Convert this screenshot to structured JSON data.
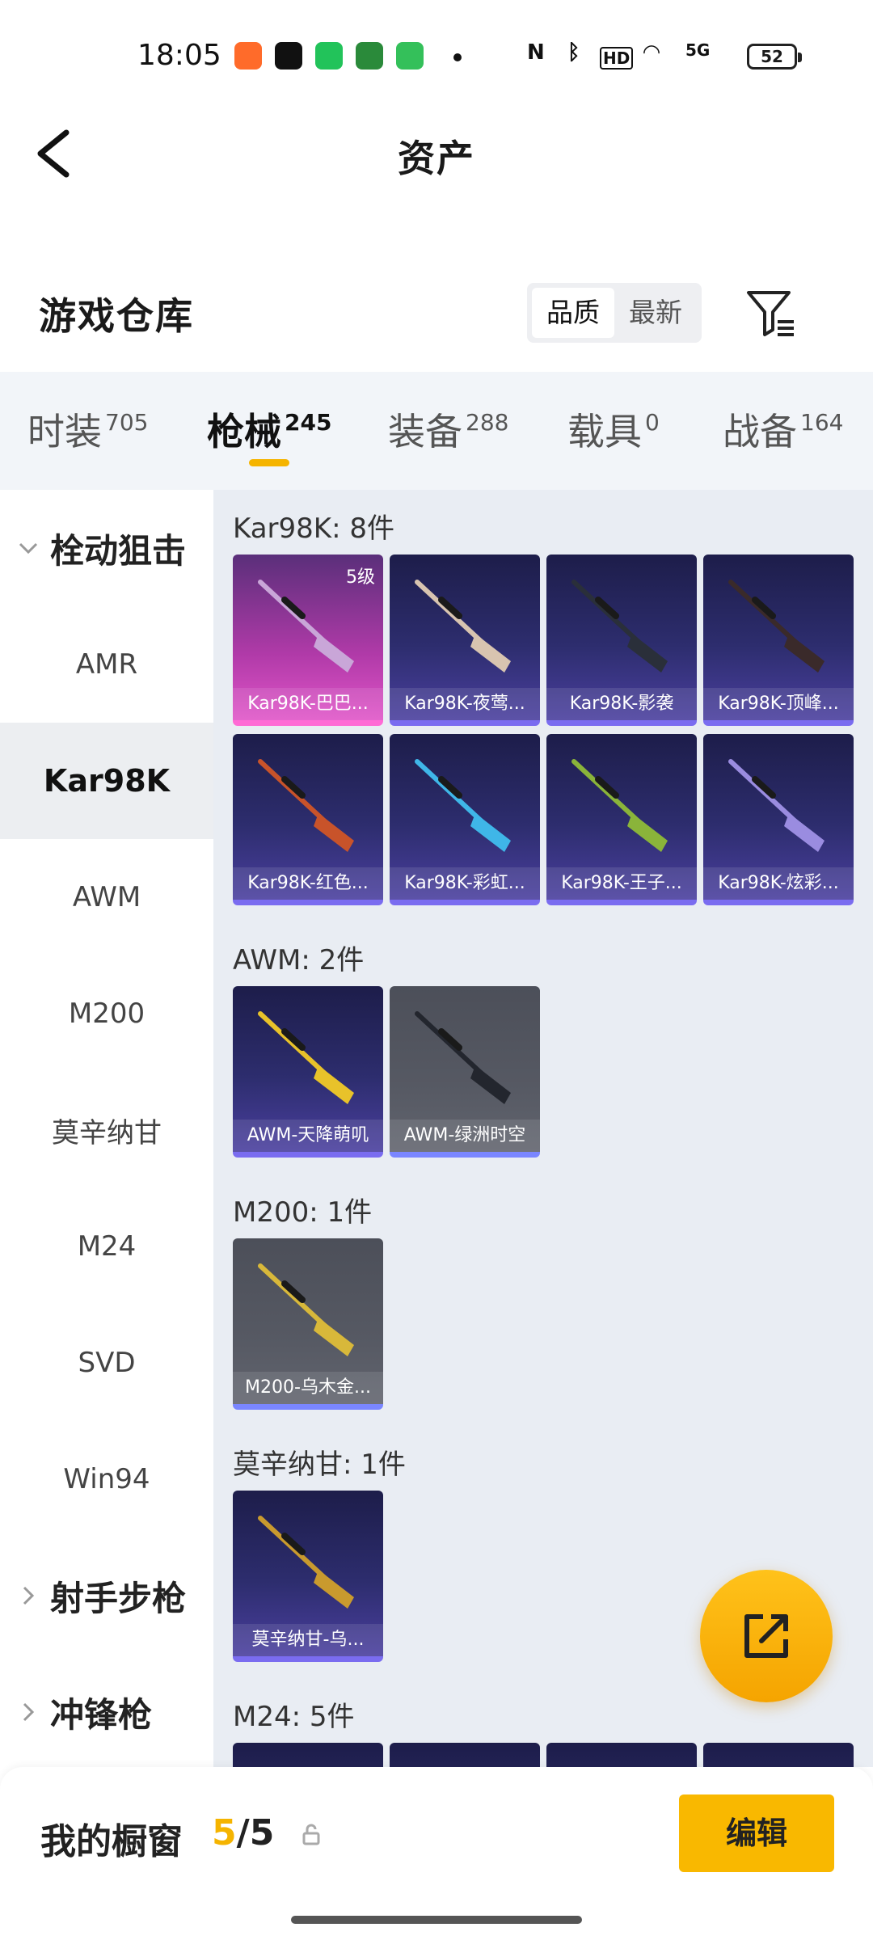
{
  "status_bar": {
    "time": "18:05",
    "icons": [
      "game-app-icon",
      "tiktok-icon",
      "green-app-icon",
      "vpn-app-icon",
      "shield-app-icon",
      "nfc-icon",
      "bluetooth-icon",
      "hd-icon",
      "wifi-icon",
      "signal-5g-icon"
    ],
    "hd": "HD",
    "net": "5G",
    "battery": "52"
  },
  "header": {
    "title": "资产"
  },
  "warehouse": {
    "title": "游戏仓库",
    "sort_options": [
      "品质",
      "最新"
    ],
    "sort_selected": "品质"
  },
  "tabs": [
    {
      "label": "时装",
      "count": "705"
    },
    {
      "label": "枪械",
      "count": "245",
      "active": true
    },
    {
      "label": "装备",
      "count": "288"
    },
    {
      "label": "载具",
      "count": "0"
    },
    {
      "label": "战备",
      "count": "164"
    }
  ],
  "sidebar": {
    "group_open": "栓动狙击",
    "items": [
      "AMR",
      "Kar98K",
      "AWM",
      "M200",
      "莫辛纳甘",
      "M24",
      "SVD",
      "Win94"
    ],
    "selected": "Kar98K",
    "groups_closed": [
      "射手步枪",
      "冲锋枪"
    ]
  },
  "groups": [
    {
      "label": "Kar98K: 8件",
      "items": [
        {
          "name": "Kar98K-巴巴...",
          "level": "5级",
          "style": "pink",
          "gun": "#c9a6d8"
        },
        {
          "name": "Kar98K-夜莺...",
          "style": "purple",
          "gun": "#d8c4b0"
        },
        {
          "name": "Kar98K-影袭",
          "style": "purple",
          "gun": "#2a2f3a"
        },
        {
          "name": "Kar98K-顶峰...",
          "style": "purple",
          "gun": "#3a2a2a"
        },
        {
          "name": "Kar98K-红色...",
          "style": "purple",
          "gun": "#c8532a"
        },
        {
          "name": "Kar98K-彩虹...",
          "style": "purple",
          "gun": "#3fb6e8"
        },
        {
          "name": "Kar98K-王子...",
          "style": "purple",
          "gun": "#8ab43a"
        },
        {
          "name": "Kar98K-炫彩...",
          "style": "purple",
          "gun": "#9a8ce0"
        }
      ]
    },
    {
      "label": "AWM: 2件",
      "items": [
        {
          "name": "AWM-天降萌叽",
          "style": "purple",
          "gun": "#e8c22a"
        },
        {
          "name": "AWM-绿洲时空",
          "style": "gray",
          "gun": "#23262e"
        }
      ]
    },
    {
      "label": "M200: 1件",
      "items": [
        {
          "name": "M200-乌木金...",
          "style": "gray",
          "gun": "#d8b83a"
        }
      ]
    },
    {
      "label": "莫辛纳甘: 1件",
      "items": [
        {
          "name": "莫辛纳甘-乌...",
          "style": "purple",
          "gun": "#c99a2e"
        }
      ]
    },
    {
      "label": "M24: 5件",
      "items": []
    }
  ],
  "bottom": {
    "label": "我的橱窗",
    "count_current": "5",
    "count_sep": "/",
    "count_total": "5",
    "edit_label": "编辑"
  },
  "colors": {
    "accent": "#f5b400",
    "content_bg": "#e9edf3",
    "card_purple": "#2d2d6e",
    "card_pink": "#c03ab0",
    "card_gray": "#565963"
  }
}
